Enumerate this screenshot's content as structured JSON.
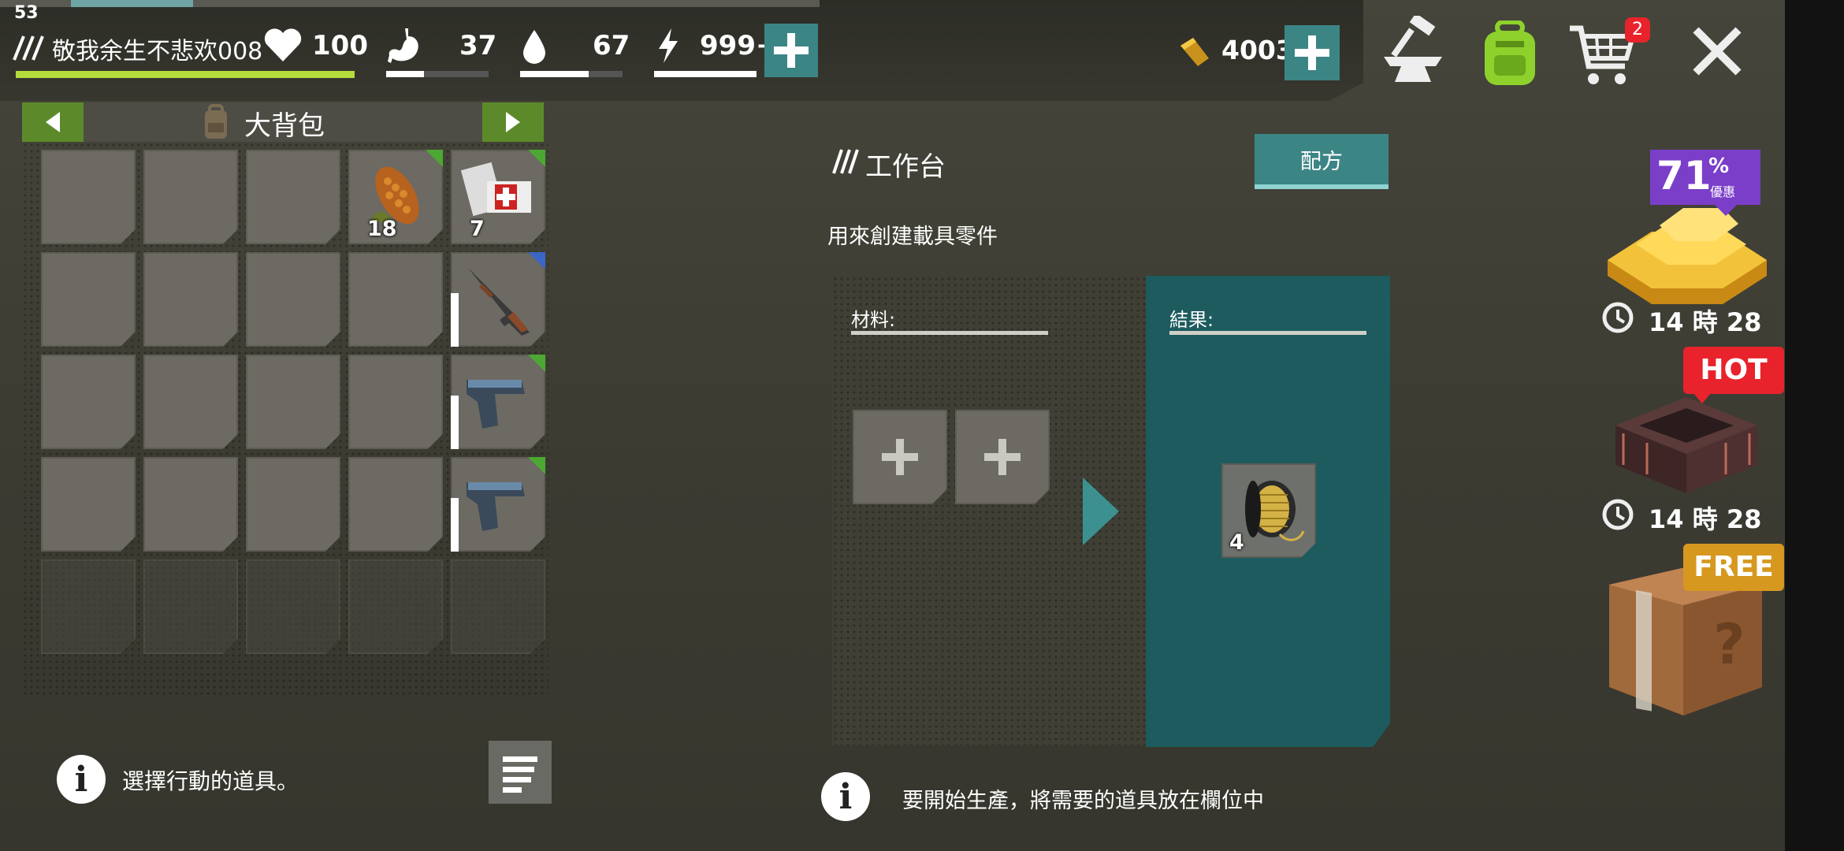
{
  "player": {
    "level": "53",
    "name": "敬我余生不悲欢008",
    "health": "100",
    "hunger": "37",
    "hunger_pct": 0.37,
    "thirst": "67",
    "thirst_pct": 0.67,
    "energy": "999+",
    "energy_pct": 1.0,
    "xp_pct": 0.12
  },
  "currency": {
    "gold": "4003"
  },
  "topbar": {
    "cart_badge": "2",
    "icons": [
      "hammer-anvil-icon",
      "backpack-icon",
      "cart-icon",
      "close-icon"
    ]
  },
  "inventory": {
    "title": "大背包",
    "slots": [
      {
        "count": ""
      },
      {
        "count": ""
      },
      {
        "count": ""
      },
      {
        "count": "18",
        "item": "corn-icon",
        "flag": "green"
      },
      {
        "count": "7",
        "item": "bandage-icon",
        "flag": "green"
      },
      {
        "count": ""
      },
      {
        "count": ""
      },
      {
        "count": ""
      },
      {
        "count": ""
      },
      {
        "count": "",
        "item": "shotgun-icon",
        "flag": "blue",
        "bar": true
      },
      {
        "count": ""
      },
      {
        "count": ""
      },
      {
        "count": ""
      },
      {
        "count": ""
      },
      {
        "count": "",
        "item": "pistol-icon",
        "flag": "green",
        "bar": true
      },
      {
        "count": ""
      },
      {
        "count": ""
      },
      {
        "count": ""
      },
      {
        "count": ""
      },
      {
        "count": "",
        "item": "pistol-icon",
        "flag": "green",
        "bar": true
      }
    ]
  },
  "left_info": "選擇行動的道具。",
  "workbench": {
    "title": "工作台",
    "recipe_button": "配方",
    "description": "用來創建載具零件",
    "materials_label": "材料:",
    "result_label": "結果:",
    "result_count": "4",
    "info": "要開始生產，將需要的道具放在欄位中"
  },
  "offers": [
    {
      "discount": "71",
      "percent": "%",
      "discount_label": "優惠",
      "timer": "14 時 28"
    },
    {
      "tag": "HOT",
      "timer": "14 時 28"
    },
    {
      "tag": "FREE"
    }
  ],
  "colors": {
    "accent": "#3c8585",
    "teal_panel": "#1d5b5e",
    "green_nav": "#5c8a2a",
    "hot": "#e8232b",
    "free": "#d6981f",
    "discount": "#7b3ec9"
  }
}
